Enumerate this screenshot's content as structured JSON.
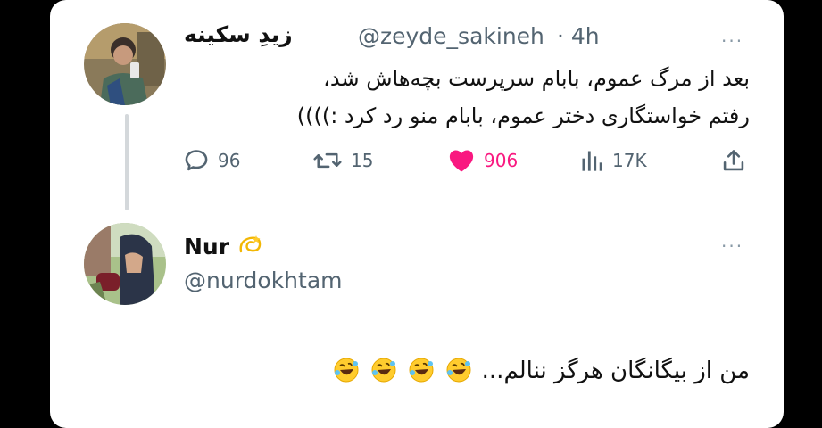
{
  "tweet": {
    "display_name": "زیدِ سکینه",
    "handle": "@zeyde_sakineh",
    "time": "· 4h",
    "line1": "بعد از مرگ عموم، بابام سرپرست بچه‌هاش شد،",
    "line2": "رفتم خواستگاری دختر عموم، بابام منو رد کرد :))))",
    "actions": {
      "replies": "96",
      "retweets": "15",
      "likes": "906",
      "views": "17K"
    },
    "like_color": "#f91880"
  },
  "reply": {
    "display_name": "Nur",
    "handle": "@nurdokhtam",
    "text": "من از بیگانگان هرگز ننالم...",
    "emoji_icons": [
      "rolling-laughing-icon",
      "rolling-laughing-icon",
      "rolling-laughing-icon",
      "rolling-laughing-icon"
    ]
  },
  "more_icon": "···"
}
